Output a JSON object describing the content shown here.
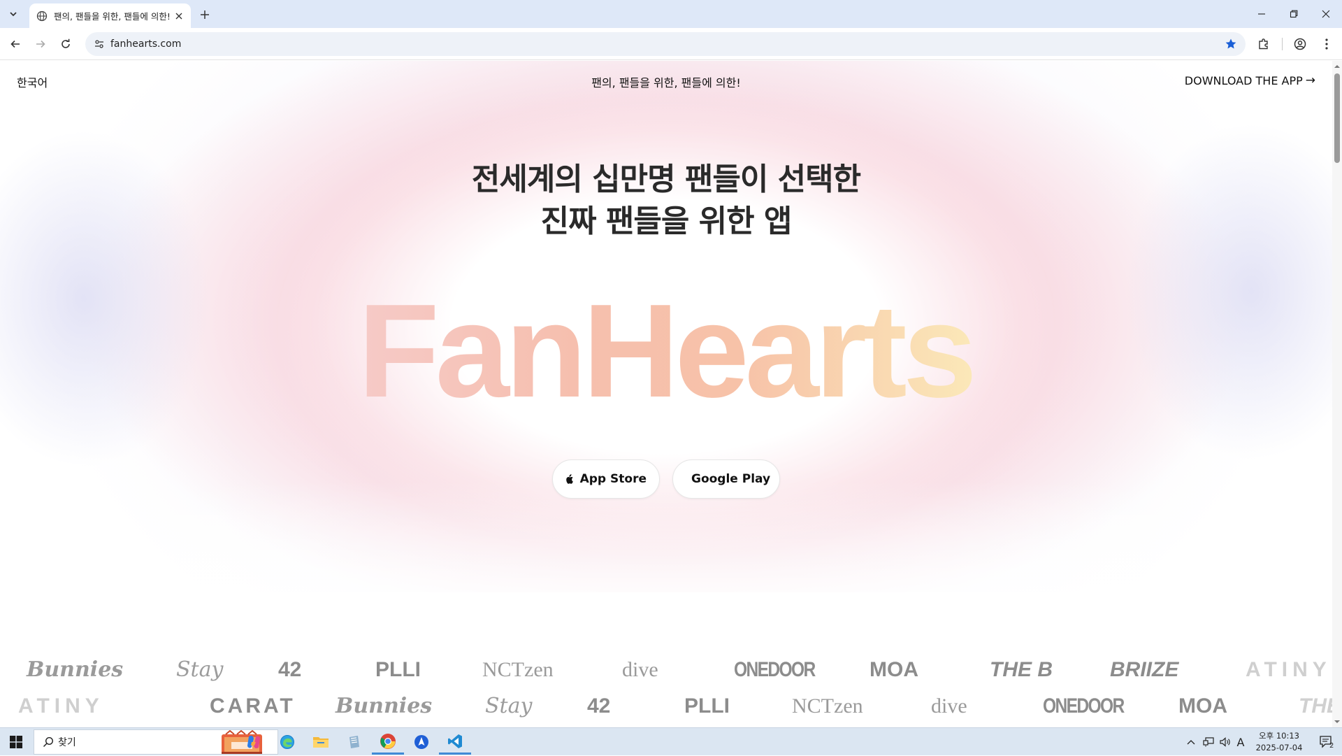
{
  "browser": {
    "tab_title": "팬의, 팬들을 위한, 팬들에 의한!",
    "url": "fanhearts.com"
  },
  "site": {
    "language": "한국어",
    "tagline": "팬의, 팬들을 위한, 팬들에 의한!",
    "download_label": "DOWNLOAD THE APP",
    "headline_line1": "전세계의 십만명 팬들이 선택한",
    "headline_line2": "진짜 팬들을 위한 앱",
    "logo_text": "FanHearts",
    "app_store_label": "App Store",
    "google_play_label": "Google Play",
    "colors": {
      "logo_start": "#f6c9c5",
      "logo_mid": "#f7c2a8",
      "logo_end": "#fbe6b4"
    }
  },
  "fandoms_row1": [
    "Bunnies",
    "Stay",
    "42",
    "PLLI",
    "NCTzen",
    "dive",
    "ONEDOOR",
    "MOA",
    "THE B",
    "BRIIZE",
    "ATINY"
  ],
  "fandoms_row2": [
    "ATINY",
    "CARAT",
    "Bunnies",
    "Stay",
    "42",
    "PLLI",
    "NCTzen",
    "dive",
    "ONEDOOR",
    "MOA",
    "THE"
  ],
  "taskbar": {
    "search_placeholder": "찾기",
    "clock_time": "오후 10:13",
    "clock_date": "2025-07-04",
    "ime_indicator": "A",
    "notification_count": "2"
  }
}
